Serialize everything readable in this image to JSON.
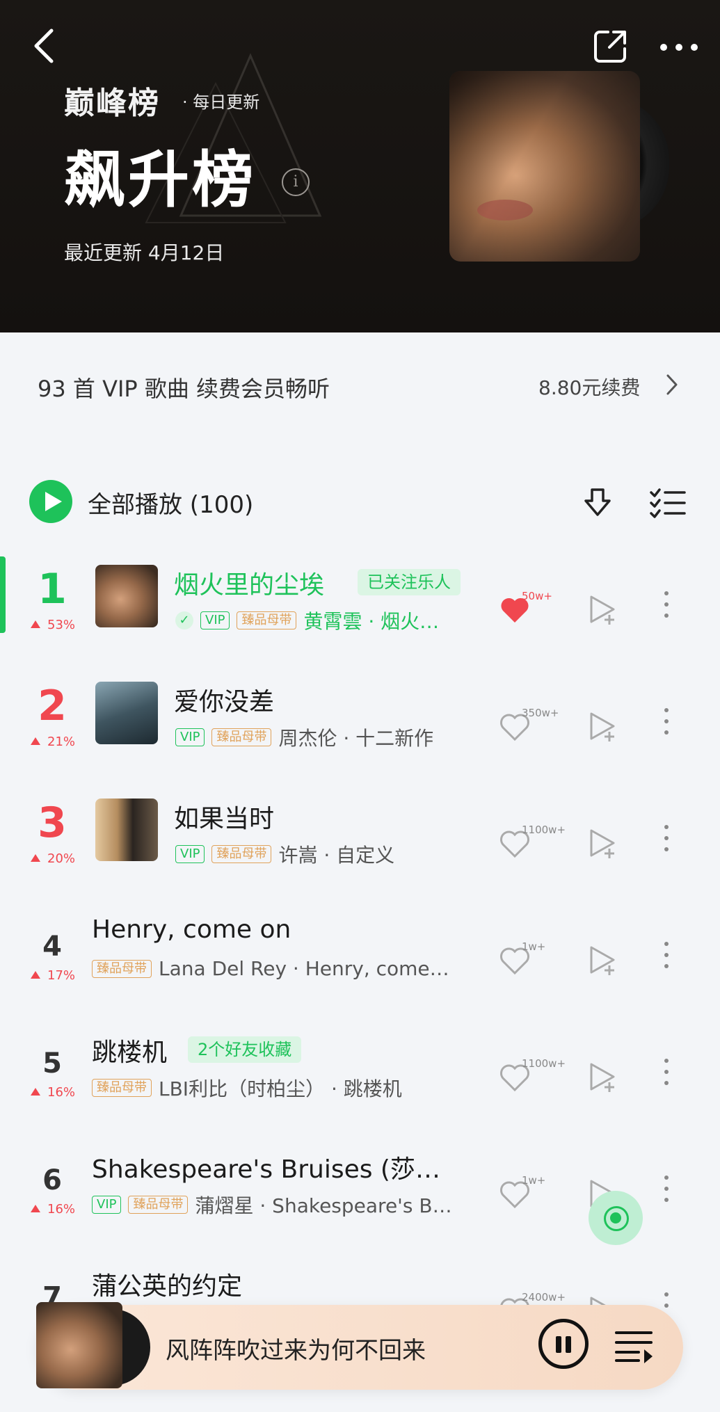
{
  "header": {
    "brand": "巅峰榜",
    "daily": "· 每日更新",
    "title": "飙升榜",
    "info_icon": "i",
    "updated": "最近更新 4月12日"
  },
  "vip_bar": {
    "text": "93 首 VIP 歌曲 续费会员畅听",
    "renew": "8.80元续费"
  },
  "play_all": {
    "label": "全部播放 (100)"
  },
  "songs": [
    {
      "rank": "1",
      "trend": "53%",
      "title": "烟火里的尘埃",
      "pill": "已关注乐人",
      "vip": "VIP",
      "master": "臻品母带",
      "meta": "黄霄雲 · 烟火…",
      "count": "50w+",
      "liked": true,
      "active": true
    },
    {
      "rank": "2",
      "trend": "21%",
      "title": "爱你没差",
      "pill": "",
      "vip": "VIP",
      "master": "臻品母带",
      "meta": "周杰伦 · 十二新作",
      "count": "350w+"
    },
    {
      "rank": "3",
      "trend": "20%",
      "title": "如果当时",
      "pill": "",
      "vip": "VIP",
      "master": "臻品母带",
      "meta": "许嵩 · 自定义",
      "count": "1100w+"
    },
    {
      "rank": "4",
      "trend": "17%",
      "title": "Henry, come on",
      "pill": "",
      "vip": "",
      "master": "臻品母带",
      "meta": "Lana Del Rey · Henry, come…",
      "count": "1w+"
    },
    {
      "rank": "5",
      "trend": "16%",
      "title": "跳楼机",
      "pill": "2个好友收藏",
      "vip": "",
      "master": "臻品母带",
      "meta": "LBI利比（时柏尘） · 跳楼机",
      "count": "1100w+"
    },
    {
      "rank": "6",
      "trend": "16%",
      "title": "Shakespeare's Bruises (莎…",
      "pill": "",
      "vip": "VIP",
      "master": "臻品母带",
      "meta": "蒲熠星 · Shakespeare's B…",
      "count": "1w+"
    },
    {
      "rank": "7",
      "trend": "",
      "title": "蒲公英的约定",
      "pill": "",
      "vip": "",
      "master": "",
      "meta": "",
      "count": "2400w+"
    }
  ],
  "player": {
    "title": "风阵阵吹过来为何不回来"
  },
  "colors": {
    "accent": "#1ec25a",
    "rank_red": "#f0474f",
    "header_bg": "#14110f",
    "page_bg": "#f3f5f8"
  },
  "icons": [
    "back-icon",
    "share-icon",
    "more-icon",
    "info-icon",
    "chevron-right-icon",
    "play-icon",
    "download-icon",
    "multi-select-icon",
    "heart-icon",
    "add-to-playlist-icon",
    "more-vertical-icon",
    "locate-icon",
    "pause-icon",
    "playlist-icon"
  ]
}
